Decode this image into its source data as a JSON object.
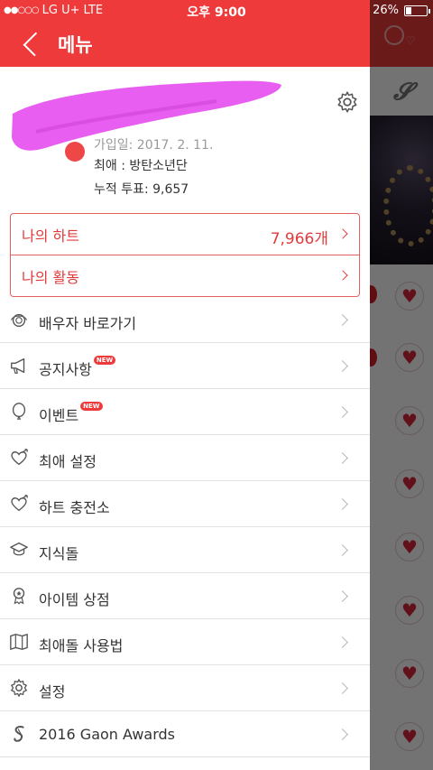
{
  "status_bar": {
    "signal": "●●○○○",
    "carrier": "LG U+",
    "network": "LTE",
    "time": "오후 9:00",
    "battery": "26%",
    "battery_level": 0.26
  },
  "header": {
    "title": "메뉴"
  },
  "profile": {
    "join_date": "가입일: 2017. 2. 11.",
    "favorite": "최애 : 방탄소년단",
    "total_votes": "누적 투표: 9,657"
  },
  "hearts_box": {
    "my_hearts_label": "나의 하트",
    "my_hearts_value": "7,966개",
    "my_activity_label": "나의 활동"
  },
  "menu": {
    "items": [
      {
        "label": "배우자 바로가기",
        "icon": "spouse-ring-icon",
        "new": ""
      },
      {
        "label": "공지사항",
        "icon": "megaphone-icon",
        "new": "NEW"
      },
      {
        "label": "이벤트",
        "icon": "balloon-icon",
        "new": "NEW"
      },
      {
        "label": "최애 설정",
        "icon": "heart-arrow-icon",
        "new": ""
      },
      {
        "label": "하트 충전소",
        "icon": "heart-arrow-icon",
        "new": ""
      },
      {
        "label": "지식돌",
        "icon": "graduation-cap-icon",
        "new": ""
      },
      {
        "label": "아이템 상점",
        "icon": "badge-award-icon",
        "new": ""
      },
      {
        "label": "최애돌 사용법",
        "icon": "map-icon",
        "new": ""
      },
      {
        "label": "설정",
        "icon": "gear-icon",
        "new": ""
      },
      {
        "label": "2016 Gaon Awards",
        "icon": "gaon-logo-icon",
        "new": ""
      }
    ]
  },
  "colors": {
    "accent": "#ee3a3a",
    "border": "#e56060",
    "redaction": "#e85ef0"
  }
}
